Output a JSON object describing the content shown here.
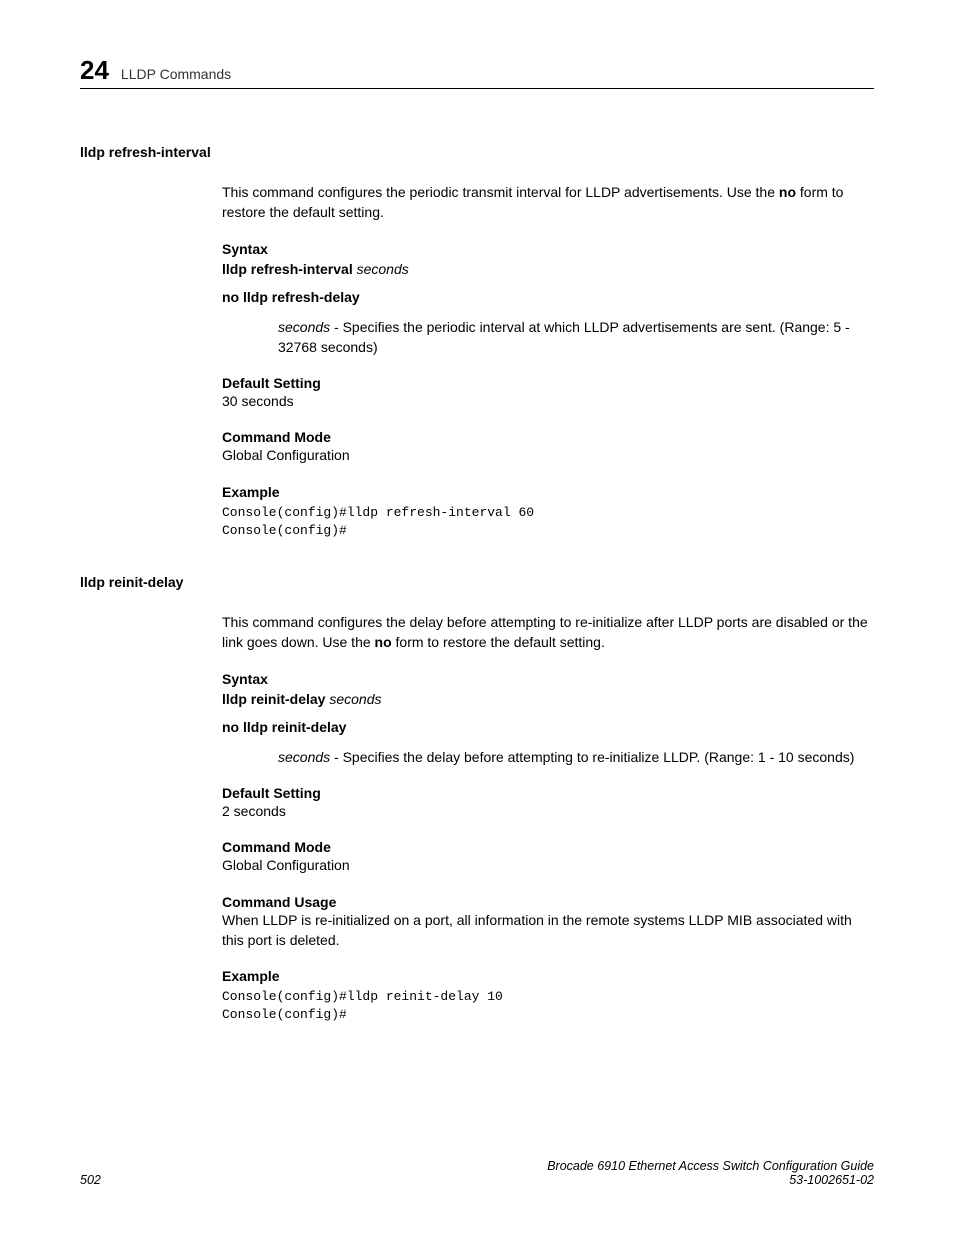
{
  "header": {
    "chapter_number": "24",
    "chapter_title": "LLDP Commands"
  },
  "cmd1": {
    "heading": "lldp refresh-interval",
    "description_a": "This command configures the periodic transmit interval for LLDP advertisements. Use the ",
    "description_bold": "no",
    "description_b": " form to restore the default setting.",
    "syntax_label": "Syntax",
    "syntax_line1_bold": "lldp refresh-interval",
    "syntax_line1_ital": " seconds",
    "syntax_line2": "no lldp refresh-delay",
    "param_ital": "seconds",
    "param_text": " - Specifies the periodic interval at which LLDP advertisements are sent. (Range: 5 - 32768 seconds)",
    "default_label": "Default Setting",
    "default_value": "30 seconds",
    "mode_label": "Command Mode",
    "mode_value": "Global Configuration",
    "example_label": "Example",
    "example_code": "Console(config)#lldp refresh-interval 60\nConsole(config)#"
  },
  "cmd2": {
    "heading": "lldp reinit-delay",
    "description_a": "This command configures the delay before attempting to re-initialize after LLDP ports are disabled or the link goes down. Use the ",
    "description_bold": "no",
    "description_b": " form to restore the default setting.",
    "syntax_label": "Syntax",
    "syntax_line1_bold": "lldp reinit-delay",
    "syntax_line1_ital": " seconds",
    "syntax_line2": "no lldp reinit-delay",
    "param_ital": "seconds",
    "param_text": " - Specifies the delay before attempting to re-initialize LLDP. (Range: 1 - 10 seconds)",
    "default_label": "Default Setting",
    "default_value": "2 seconds",
    "mode_label": "Command Mode",
    "mode_value": "Global Configuration",
    "usage_label": "Command Usage",
    "usage_text": "When LLDP is re-initialized on a port, all information in the remote systems LLDP MIB associated with this port is deleted.",
    "example_label": "Example",
    "example_code": "Console(config)#lldp reinit-delay 10\nConsole(config)#"
  },
  "footer": {
    "page_number": "502",
    "doc_title": "Brocade 6910 Ethernet Access Switch Configuration Guide",
    "doc_number": "53-1002651-02"
  }
}
